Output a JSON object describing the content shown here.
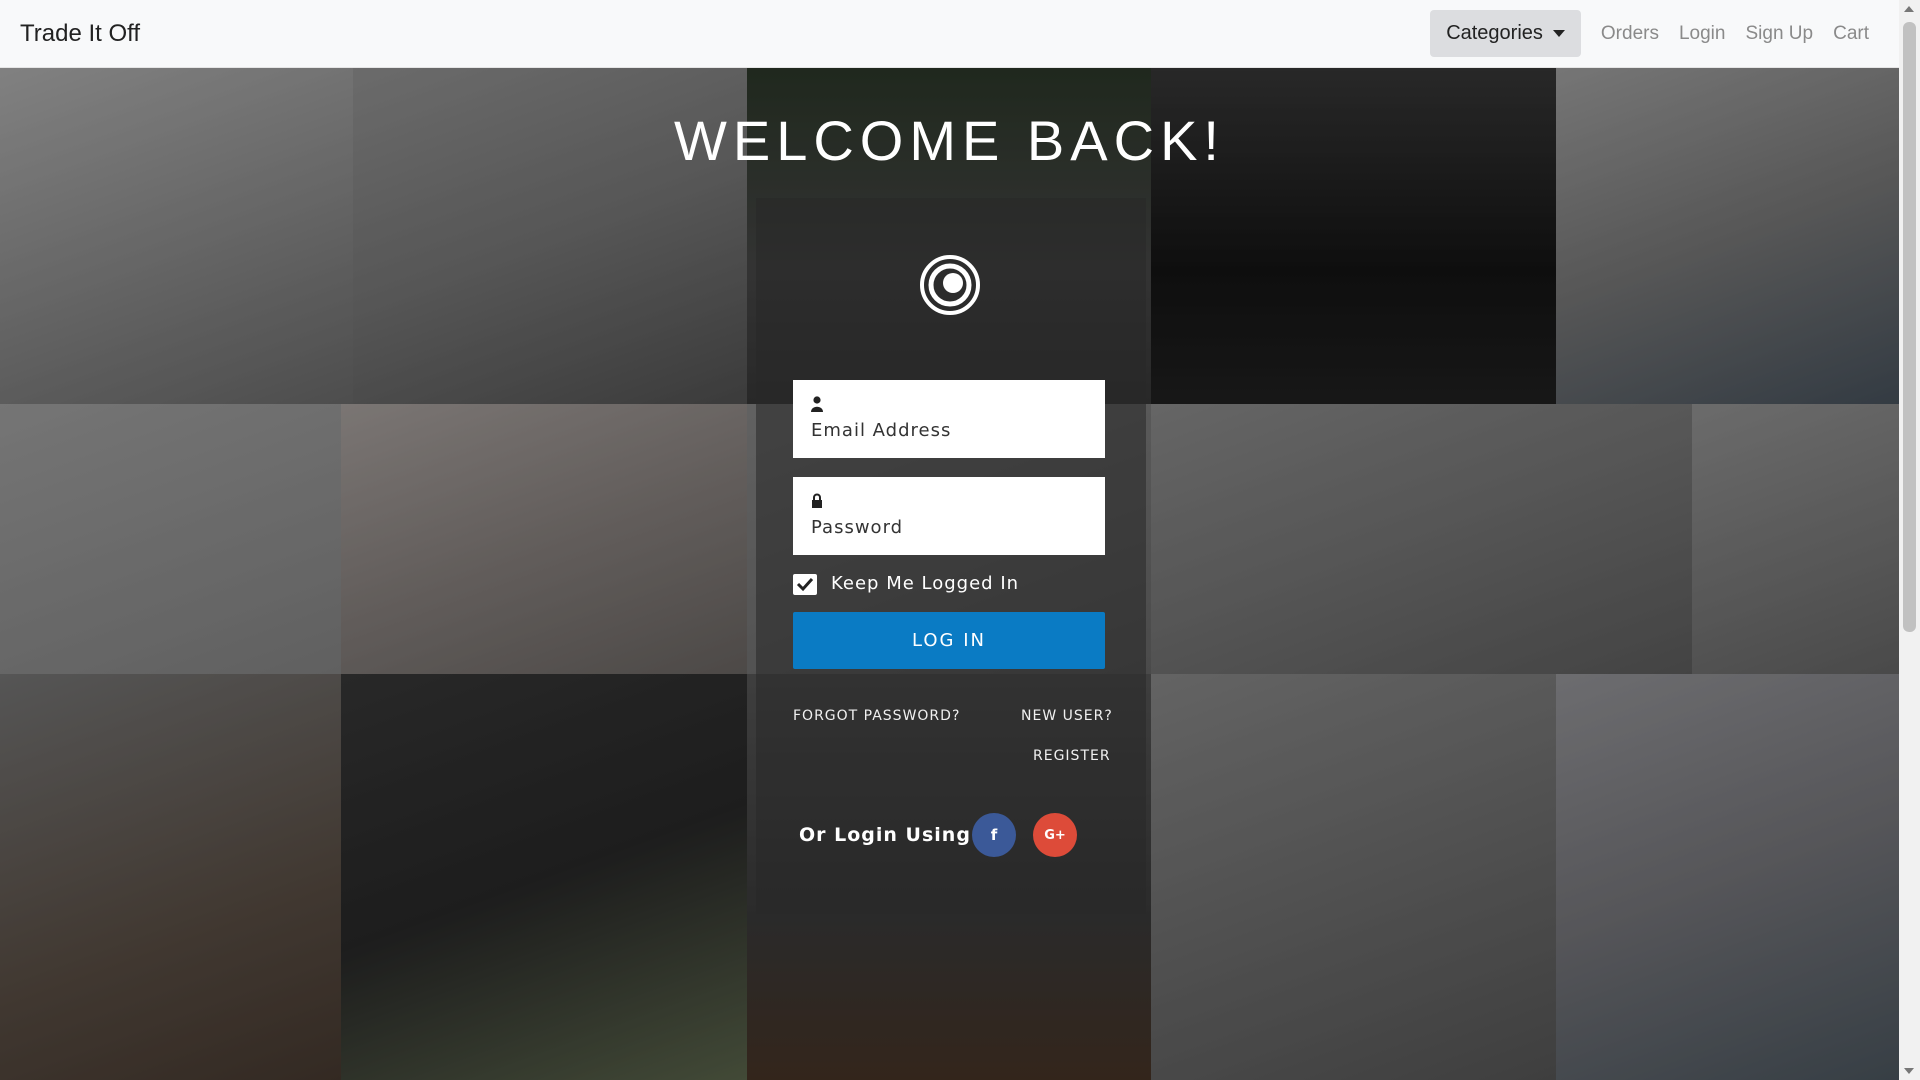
{
  "navbar": {
    "brand": "Trade It Off",
    "categories_label": "Categories",
    "links": [
      "Orders",
      "Login",
      "Sign Up",
      "Cart"
    ]
  },
  "page": {
    "heading": "WELCOME BACK!"
  },
  "login_form": {
    "email_placeholder": "Email Address",
    "password_placeholder": "Password",
    "remember_label": "Keep Me Logged In",
    "remember_checked": true,
    "submit_label": "LOG IN",
    "forgot_label": "FORGOT PASSWORD?",
    "new_user_label": "NEW USER?",
    "register_label": "REGISTER",
    "social_label": "Or Login Using :",
    "facebook_glyph": "f",
    "google_glyph": "G+"
  },
  "colors": {
    "primary_button": "#0a7bc4",
    "facebook": "#3b5998",
    "google": "#dd4b39"
  }
}
